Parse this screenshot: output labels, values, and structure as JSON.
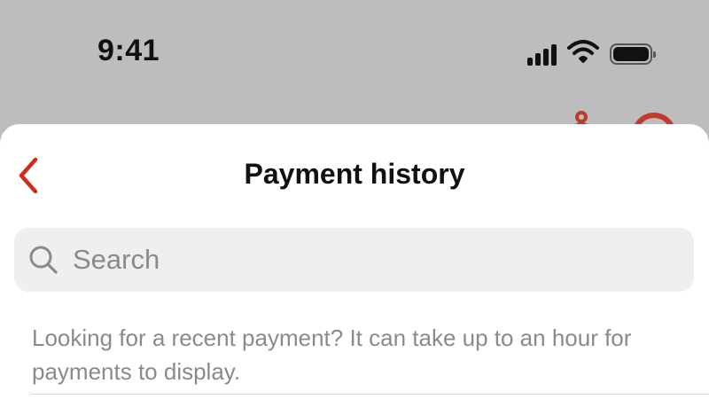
{
  "status_bar": {
    "time": "9:41",
    "icons": [
      "signal-icon",
      "wifi-icon",
      "battery-icon"
    ]
  },
  "header": {
    "title": "Payment history",
    "back_icon": "chevron-left-icon"
  },
  "search": {
    "placeholder": "Search",
    "value": "",
    "icon": "search-icon"
  },
  "info": {
    "text": "Looking for a recent payment? It can take up to an hour for payments to display."
  },
  "colors": {
    "accent": "#cc2b1e",
    "backdrop": "#bdbdbd",
    "sheet": "#ffffff",
    "search_bg": "#efefef",
    "secondary_text": "#8a8a8e"
  }
}
